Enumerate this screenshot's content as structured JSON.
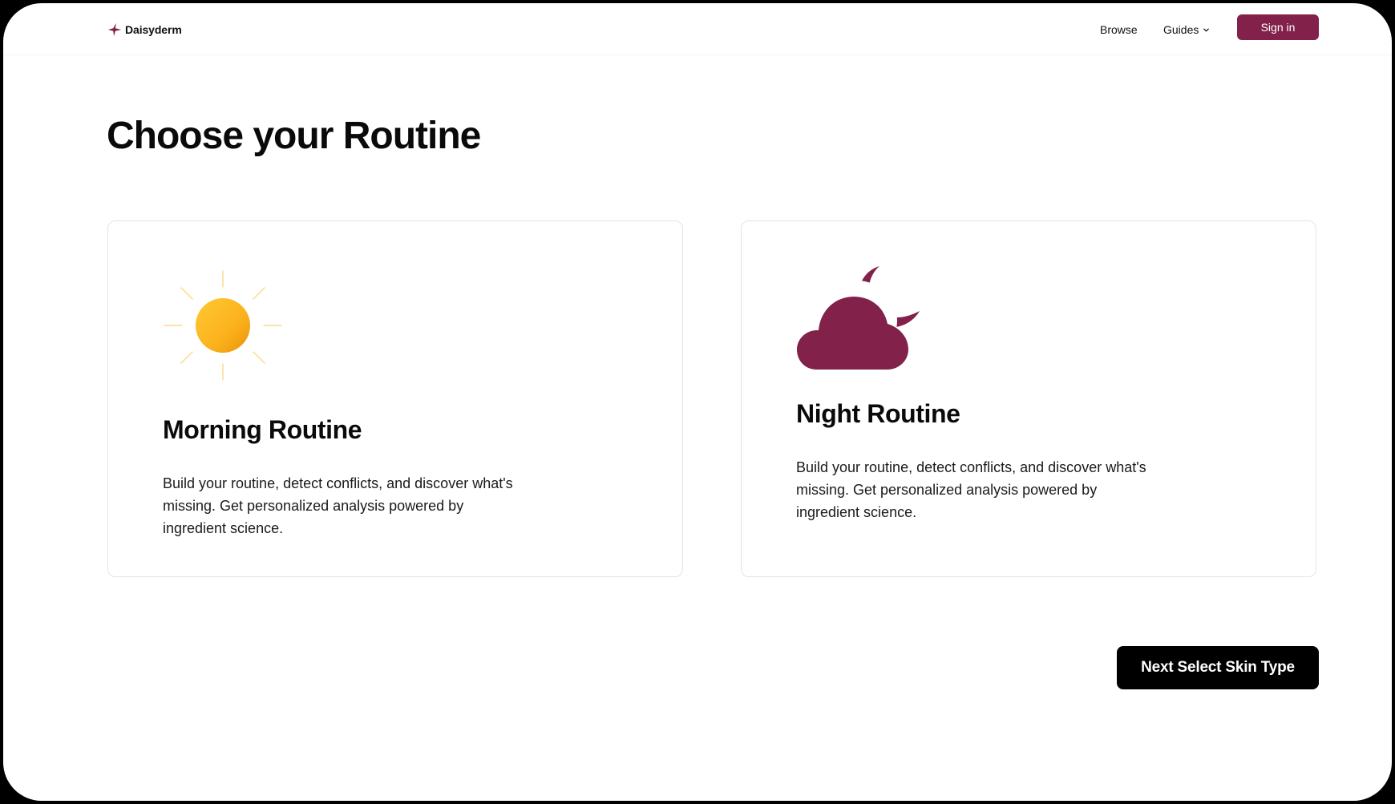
{
  "brand": {
    "name": "Daisyderm",
    "logo_icon": "sparkle-star-icon",
    "accent_color": "#82214a"
  },
  "nav": {
    "browse_label": "Browse",
    "guides_label": "Guides",
    "guides_icon": "chevron-down-icon",
    "signin_label": "Sign in"
  },
  "page": {
    "title": "Choose your Routine"
  },
  "routines": [
    {
      "icon": "sun-icon",
      "title": "Morning Routine",
      "description": "Build your routine, detect conflicts, and discover what's missing. Get personalized analysis powered by ingredient science."
    },
    {
      "icon": "cloud-moon-icon",
      "title": "Night Routine",
      "description": "Build your routine, detect conflicts, and discover what's missing. Get personalized analysis powered by ingredient science."
    }
  ],
  "footer": {
    "next_label": "Next Select Skin Type"
  }
}
